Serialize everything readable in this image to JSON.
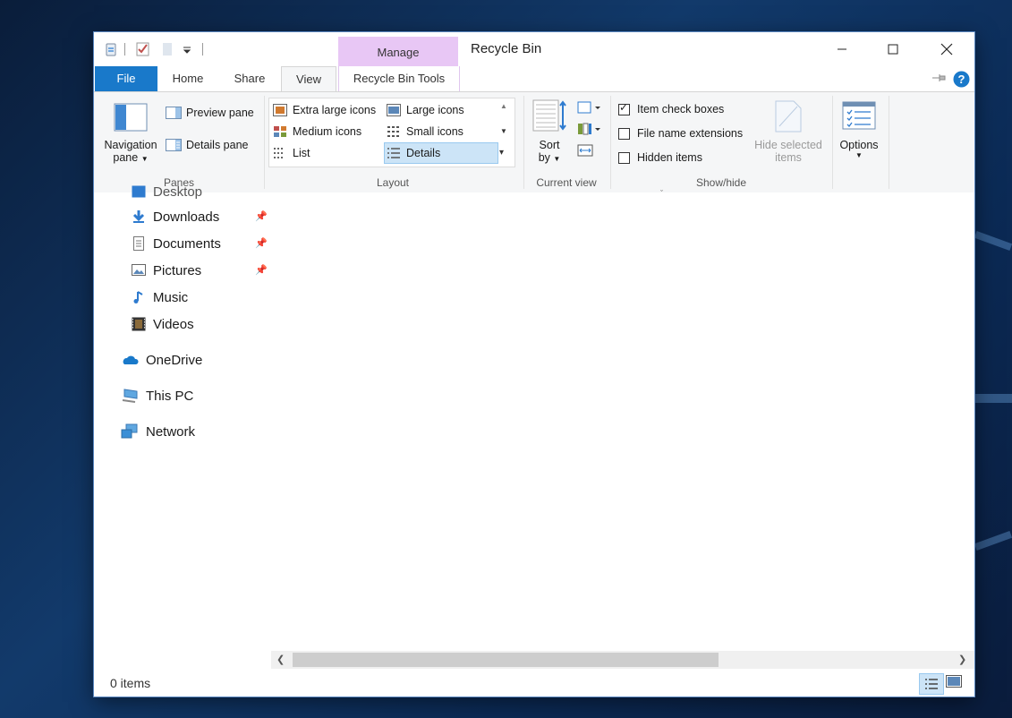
{
  "window": {
    "title": "Recycle Bin",
    "contextual_tab_group": "Manage"
  },
  "tabs": {
    "file": "File",
    "home": "Home",
    "share": "Share",
    "view": "View",
    "tools": "Recycle Bin Tools"
  },
  "ribbon": {
    "panes": {
      "label": "Panes",
      "navigation_pane_line1": "Navigation",
      "navigation_pane_line2": "pane",
      "preview_pane": "Preview pane",
      "details_pane": "Details pane"
    },
    "layout": {
      "label": "Layout",
      "items": [
        "Extra large icons",
        "Large icons",
        "Medium icons",
        "Small icons",
        "List",
        "Details"
      ],
      "selected": "Details"
    },
    "current_view": {
      "label": "Current view",
      "sort_line1": "Sort",
      "sort_line2": "by"
    },
    "show_hide": {
      "label": "Show/hide",
      "item_check_boxes": "Item check boxes",
      "file_name_extensions": "File name extensions",
      "hidden_items": "Hidden items",
      "item_check_boxes_checked": true,
      "file_name_extensions_checked": false,
      "hidden_items_checked": false,
      "hide_selected_line1": "Hide selected",
      "hide_selected_line2": "items"
    },
    "options": {
      "label": "Options"
    }
  },
  "nav": {
    "partial_item": "Desktop",
    "quick_access": [
      "Downloads",
      "Documents",
      "Pictures",
      "Music",
      "Videos"
    ],
    "onedrive": "OneDrive",
    "this_pc": "This PC",
    "network": "Network"
  },
  "status": {
    "item_count": "0 items"
  },
  "colors": {
    "file_tab": "#1979ca",
    "manage_tab": "#e8c7f5",
    "selection": "#cce4f7",
    "help": "#1979ca"
  }
}
